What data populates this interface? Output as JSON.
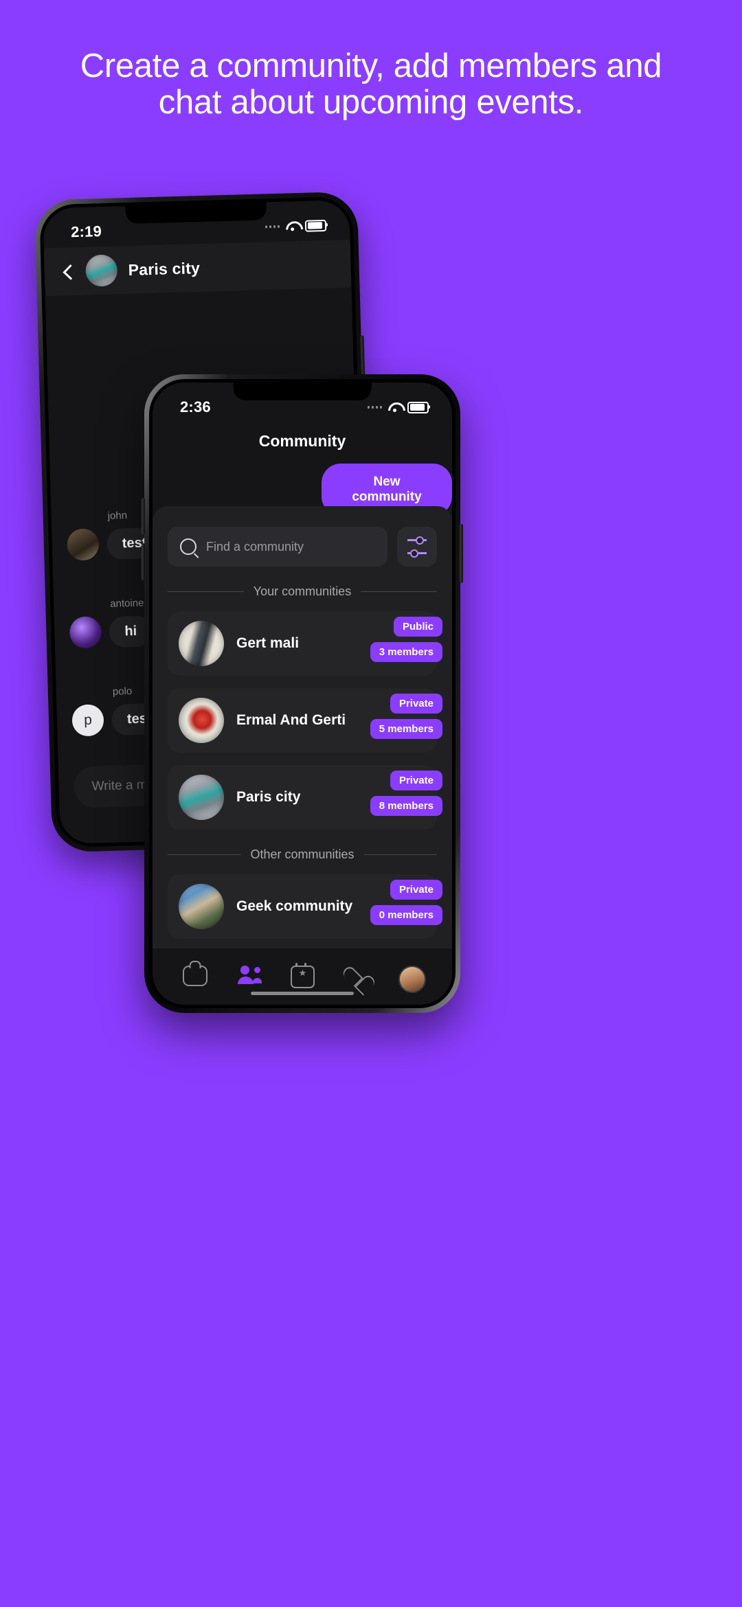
{
  "headline": "Create a community, add members and chat about upcoming events.",
  "colors": {
    "background": "#8B3DFF",
    "accent": "#8B3DFF",
    "screen": "#151517",
    "panel": "#202023",
    "row": "#252528"
  },
  "back_phone": {
    "status": {
      "time": "2:19"
    },
    "header": {
      "title": "Paris city",
      "back_label": "Back"
    },
    "messages": [
      {
        "author": "john",
        "text": "test"
      },
      {
        "author": "antoinebaqu",
        "text": "hi"
      },
      {
        "author": "polo",
        "text": "test",
        "initial": "p"
      }
    ],
    "composer": {
      "placeholder": "Write a message..."
    }
  },
  "front_phone": {
    "status": {
      "time": "2:36"
    },
    "title": "Community",
    "new_community_button": "New community",
    "search": {
      "placeholder": "Find a community"
    },
    "filter_button_label": "Filter",
    "sections": [
      {
        "label": "Your communities"
      },
      {
        "label": "Other communities"
      }
    ],
    "your_communities": [
      {
        "name": "Gert mali",
        "visibility": "Public",
        "members": "3 members"
      },
      {
        "name": "Ermal And Gerti",
        "visibility": "Private",
        "members": "5 members"
      },
      {
        "name": "Paris city",
        "visibility": "Private",
        "members": "8 members"
      }
    ],
    "other_communities": [
      {
        "name": "Geek community",
        "visibility": "Private",
        "members": "0 members"
      }
    ],
    "tabs": [
      {
        "name": "home",
        "label": "Home",
        "active": false
      },
      {
        "name": "people",
        "label": "People",
        "active": true
      },
      {
        "name": "events",
        "label": "Events",
        "active": false
      },
      {
        "name": "likes",
        "label": "Likes",
        "active": false
      },
      {
        "name": "profile",
        "label": "Profile",
        "active": false
      }
    ]
  }
}
